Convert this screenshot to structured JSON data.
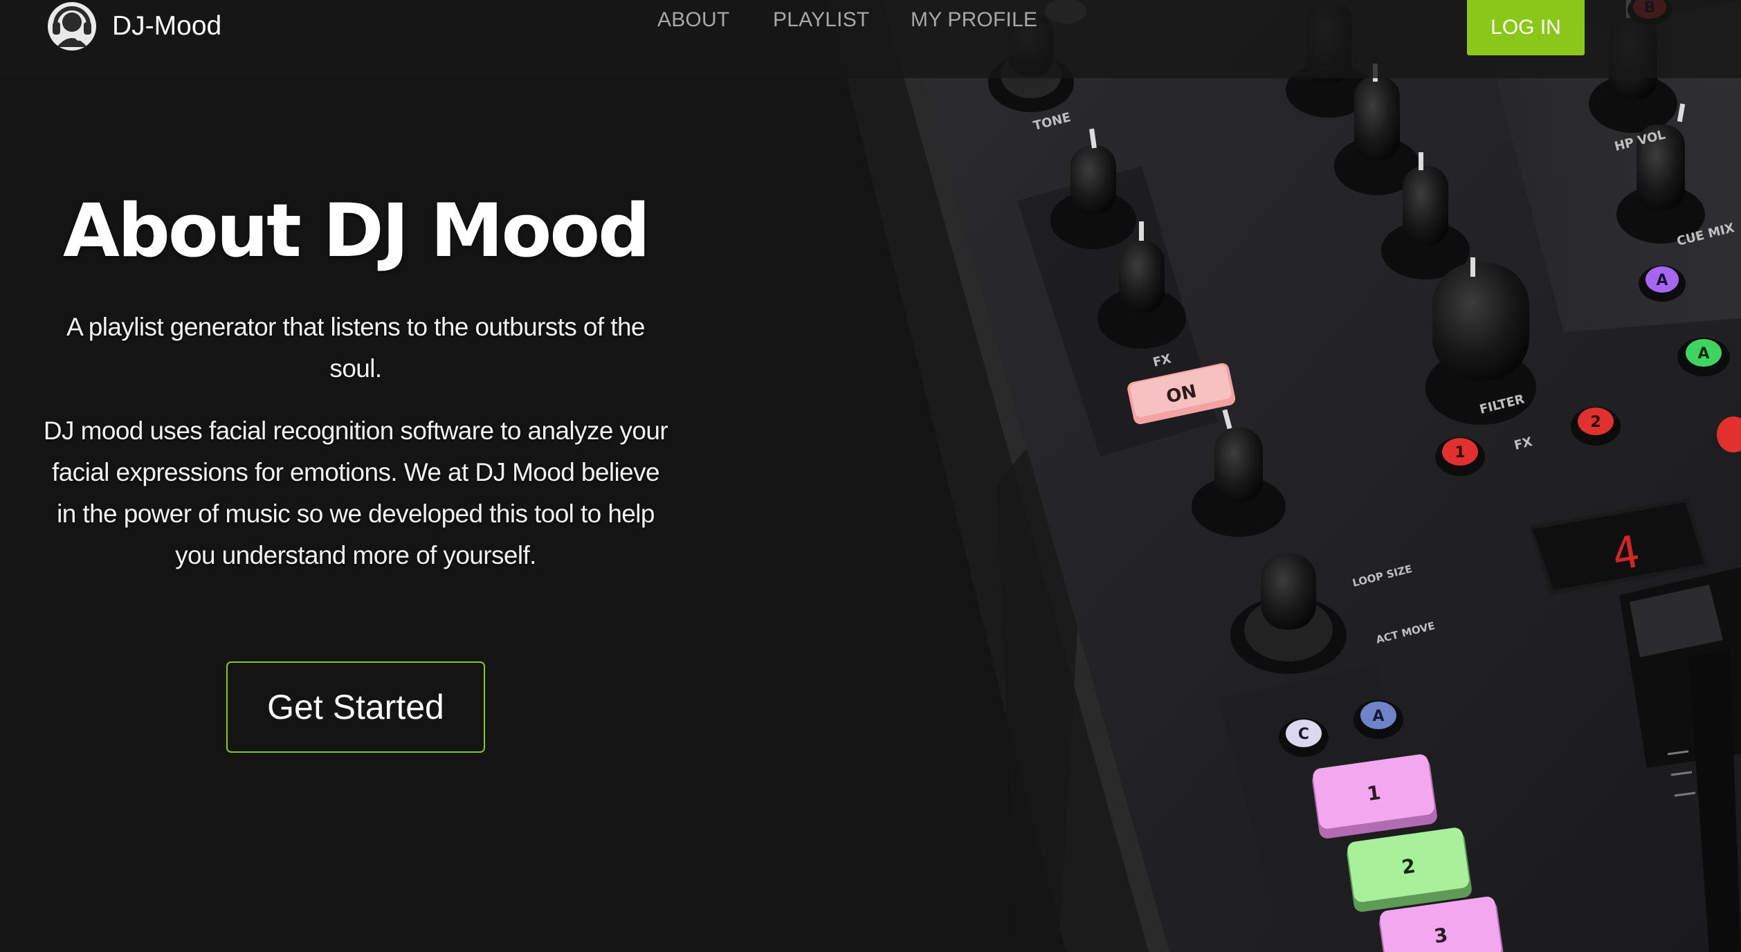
{
  "nav": {
    "brand_name": "DJ-Mood",
    "links": [
      "ABOUT",
      "PLAYLIST",
      "MY PROFILE"
    ],
    "login_label": "LOG IN"
  },
  "hero": {
    "title": "About DJ Mood",
    "tagline": "A playlist generator that listens to the outbursts of the soul.",
    "description": "DJ mood uses facial recognition software to analyze your facial expressions for emotions. We at DJ Mood believe in the power of music so we developed this tool to help you understand more of yourself.",
    "cta_label": "Get Started"
  },
  "controller": {
    "labels": {
      "tone": "TONE",
      "fx": "FX",
      "fx2": "FX",
      "on": "ON",
      "filter": "FILTER",
      "hp_vol": "HP VOL",
      "cue_mix": "CUE MIX",
      "loop_size": "LOOP SIZE",
      "act_move": "ACT MOVE",
      "display": "4"
    },
    "pads": [
      "1",
      "2",
      "3"
    ],
    "buttons": [
      "A",
      "C",
      "A",
      "A",
      "1",
      "2",
      "B"
    ]
  },
  "colors": {
    "accent": "#8bc61a",
    "background": "#141414",
    "nav_text": "#a8a8a8",
    "pad_pink": "#f2a8ee",
    "pad_green": "#a8f09a",
    "led_red": "#e0312f"
  }
}
